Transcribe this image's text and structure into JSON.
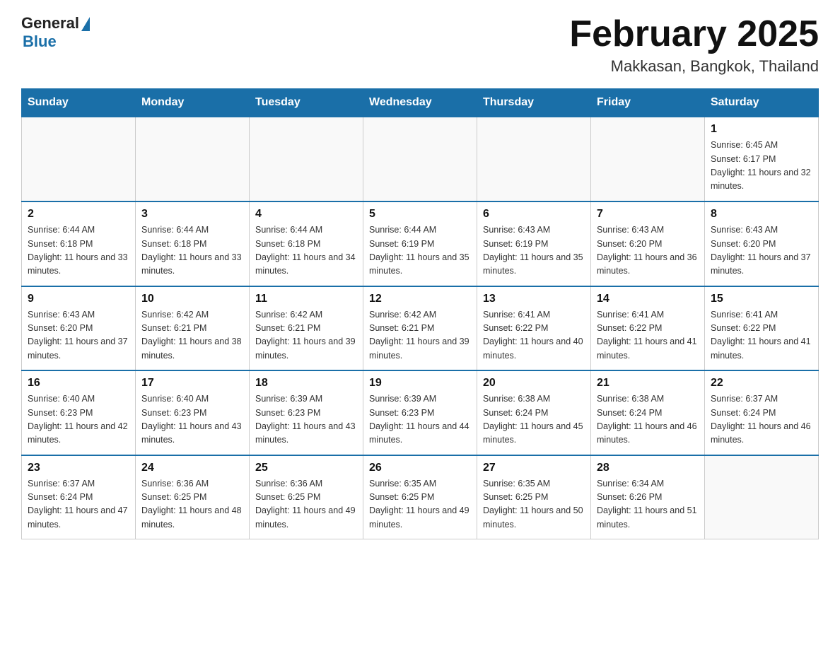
{
  "header": {
    "logo_general": "General",
    "logo_blue": "Blue",
    "month_title": "February 2025",
    "location": "Makkasan, Bangkok, Thailand"
  },
  "weekdays": [
    "Sunday",
    "Monday",
    "Tuesday",
    "Wednesday",
    "Thursday",
    "Friday",
    "Saturday"
  ],
  "weeks": [
    [
      {
        "day": "",
        "info": ""
      },
      {
        "day": "",
        "info": ""
      },
      {
        "day": "",
        "info": ""
      },
      {
        "day": "",
        "info": ""
      },
      {
        "day": "",
        "info": ""
      },
      {
        "day": "",
        "info": ""
      },
      {
        "day": "1",
        "info": "Sunrise: 6:45 AM\nSunset: 6:17 PM\nDaylight: 11 hours and 32 minutes."
      }
    ],
    [
      {
        "day": "2",
        "info": "Sunrise: 6:44 AM\nSunset: 6:18 PM\nDaylight: 11 hours and 33 minutes."
      },
      {
        "day": "3",
        "info": "Sunrise: 6:44 AM\nSunset: 6:18 PM\nDaylight: 11 hours and 33 minutes."
      },
      {
        "day": "4",
        "info": "Sunrise: 6:44 AM\nSunset: 6:18 PM\nDaylight: 11 hours and 34 minutes."
      },
      {
        "day": "5",
        "info": "Sunrise: 6:44 AM\nSunset: 6:19 PM\nDaylight: 11 hours and 35 minutes."
      },
      {
        "day": "6",
        "info": "Sunrise: 6:43 AM\nSunset: 6:19 PM\nDaylight: 11 hours and 35 minutes."
      },
      {
        "day": "7",
        "info": "Sunrise: 6:43 AM\nSunset: 6:20 PM\nDaylight: 11 hours and 36 minutes."
      },
      {
        "day": "8",
        "info": "Sunrise: 6:43 AM\nSunset: 6:20 PM\nDaylight: 11 hours and 37 minutes."
      }
    ],
    [
      {
        "day": "9",
        "info": "Sunrise: 6:43 AM\nSunset: 6:20 PM\nDaylight: 11 hours and 37 minutes."
      },
      {
        "day": "10",
        "info": "Sunrise: 6:42 AM\nSunset: 6:21 PM\nDaylight: 11 hours and 38 minutes."
      },
      {
        "day": "11",
        "info": "Sunrise: 6:42 AM\nSunset: 6:21 PM\nDaylight: 11 hours and 39 minutes."
      },
      {
        "day": "12",
        "info": "Sunrise: 6:42 AM\nSunset: 6:21 PM\nDaylight: 11 hours and 39 minutes."
      },
      {
        "day": "13",
        "info": "Sunrise: 6:41 AM\nSunset: 6:22 PM\nDaylight: 11 hours and 40 minutes."
      },
      {
        "day": "14",
        "info": "Sunrise: 6:41 AM\nSunset: 6:22 PM\nDaylight: 11 hours and 41 minutes."
      },
      {
        "day": "15",
        "info": "Sunrise: 6:41 AM\nSunset: 6:22 PM\nDaylight: 11 hours and 41 minutes."
      }
    ],
    [
      {
        "day": "16",
        "info": "Sunrise: 6:40 AM\nSunset: 6:23 PM\nDaylight: 11 hours and 42 minutes."
      },
      {
        "day": "17",
        "info": "Sunrise: 6:40 AM\nSunset: 6:23 PM\nDaylight: 11 hours and 43 minutes."
      },
      {
        "day": "18",
        "info": "Sunrise: 6:39 AM\nSunset: 6:23 PM\nDaylight: 11 hours and 43 minutes."
      },
      {
        "day": "19",
        "info": "Sunrise: 6:39 AM\nSunset: 6:23 PM\nDaylight: 11 hours and 44 minutes."
      },
      {
        "day": "20",
        "info": "Sunrise: 6:38 AM\nSunset: 6:24 PM\nDaylight: 11 hours and 45 minutes."
      },
      {
        "day": "21",
        "info": "Sunrise: 6:38 AM\nSunset: 6:24 PM\nDaylight: 11 hours and 46 minutes."
      },
      {
        "day": "22",
        "info": "Sunrise: 6:37 AM\nSunset: 6:24 PM\nDaylight: 11 hours and 46 minutes."
      }
    ],
    [
      {
        "day": "23",
        "info": "Sunrise: 6:37 AM\nSunset: 6:24 PM\nDaylight: 11 hours and 47 minutes."
      },
      {
        "day": "24",
        "info": "Sunrise: 6:36 AM\nSunset: 6:25 PM\nDaylight: 11 hours and 48 minutes."
      },
      {
        "day": "25",
        "info": "Sunrise: 6:36 AM\nSunset: 6:25 PM\nDaylight: 11 hours and 49 minutes."
      },
      {
        "day": "26",
        "info": "Sunrise: 6:35 AM\nSunset: 6:25 PM\nDaylight: 11 hours and 49 minutes."
      },
      {
        "day": "27",
        "info": "Sunrise: 6:35 AM\nSunset: 6:25 PM\nDaylight: 11 hours and 50 minutes."
      },
      {
        "day": "28",
        "info": "Sunrise: 6:34 AM\nSunset: 6:26 PM\nDaylight: 11 hours and 51 minutes."
      },
      {
        "day": "",
        "info": ""
      }
    ]
  ]
}
